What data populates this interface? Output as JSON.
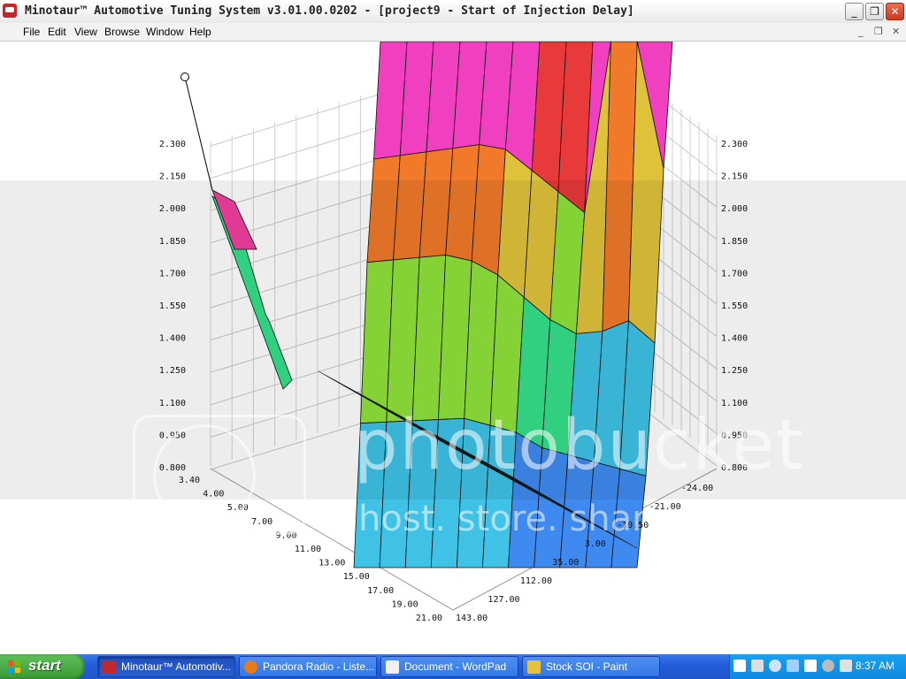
{
  "window": {
    "title": "Minotaur™ Automotive Tuning System  v3.01.00.0202 - [project9 - Start of Injection Delay]",
    "controls": {
      "minimize": "_",
      "restore": "❐",
      "close": "✕"
    }
  },
  "menu": {
    "items": [
      "File",
      "Edit",
      "View",
      "Browse",
      "Window",
      "Help"
    ],
    "mdi_controls": {
      "minimize": "_",
      "restore": "❐",
      "close": "✕"
    }
  },
  "chart_data": {
    "type": "surface3d",
    "title": "",
    "z_ticks": [
      "2.300",
      "2.150",
      "2.000",
      "1.850",
      "1.700",
      "1.550",
      "1.400",
      "1.250",
      "1.100",
      "0.950",
      "0.800"
    ],
    "z_range": [
      0.8,
      2.3
    ],
    "x_ticks": [
      "3.40",
      "4.00",
      "5.00",
      "7.00",
      "9.00",
      "11.00",
      "13.00",
      "15.00",
      "17.00",
      "19.00",
      "21.00"
    ],
    "y_ticks": [
      "143.00",
      "127.00",
      "112.00",
      "35.00",
      "3.00",
      "-10.50",
      "-21.00",
      "-24.00"
    ],
    "grid": true,
    "colors": [
      "#3f8af0",
      "#3fc2e6",
      "#34e08a",
      "#8fe23a",
      "#e0c23a",
      "#f07a2a",
      "#e83a3a",
      "#f040c0",
      "#b040f0"
    ],
    "surface_rows": [
      [
        2.95,
        2.95,
        2.95,
        2.95,
        2.95,
        2.95,
        2.95,
        2.95,
        2.95,
        2.95,
        2.95,
        2.95
      ],
      [
        2.3,
        2.3,
        2.3,
        2.3,
        2.3,
        2.25,
        2.1,
        1.95,
        1.8,
        2.95,
        2.95,
        2.0
      ],
      [
        2.05,
        2.05,
        2.05,
        2.05,
        2.0,
        1.9,
        1.75,
        1.6,
        1.5,
        1.5,
        1.55,
        1.4
      ],
      [
        1.45,
        1.45,
        1.45,
        1.45,
        1.45,
        1.4,
        1.35,
        1.25,
        1.2,
        1.15,
        1.1,
        1.05
      ],
      [
        0.95,
        0.95,
        0.95,
        0.95,
        0.95,
        0.95,
        0.95,
        0.95,
        0.95,
        0.95,
        0.95,
        0.95
      ]
    ]
  },
  "watermark": {
    "line1": "photobucket",
    "line2": "host. store. share."
  },
  "taskbar": {
    "start_label": "start",
    "tasks": [
      {
        "label": "Minotaur™ Automotiv...",
        "icon": "minotaur-icon",
        "active": true
      },
      {
        "label": "Pandora Radio - Liste...",
        "icon": "firefox-icon",
        "active": false
      },
      {
        "label": "Document - WordPad",
        "icon": "wordpad-icon",
        "active": false
      },
      {
        "label": "Stock SOI - Paint",
        "icon": "paint-icon",
        "active": false
      }
    ],
    "clock": "8:37 AM"
  }
}
